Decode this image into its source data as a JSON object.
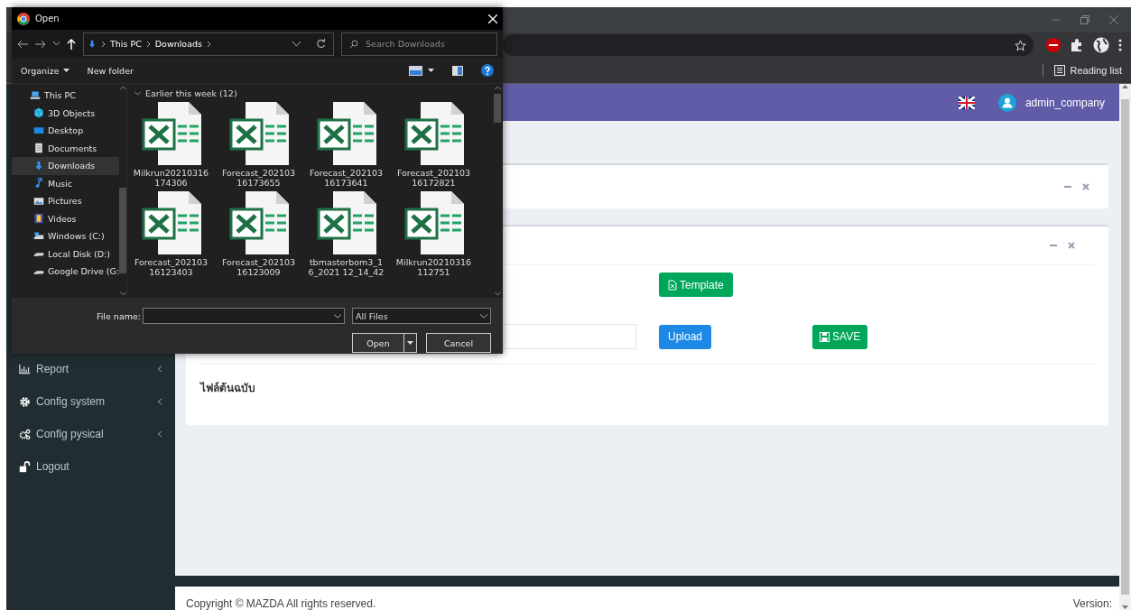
{
  "browser": {
    "reading_list": "Reading list"
  },
  "header": {
    "user": "admin_company"
  },
  "sidebar": {
    "items": [
      {
        "label": "Report",
        "kind": "chart"
      },
      {
        "label": "Config system",
        "kind": "gear"
      },
      {
        "label": "Config pysical",
        "kind": "gears"
      },
      {
        "label": "Logout",
        "kind": "lock"
      }
    ]
  },
  "upload_card": {
    "template_button": "Template",
    "upload_button": "Upload",
    "save_button": "SAVE",
    "section_title": "ไฟล์ต้นฉบับ"
  },
  "footer": {
    "copyright": "Copyright © MAZDA All rights reserved.",
    "version": "Version:"
  },
  "dialog": {
    "title": "Open",
    "breadcrumb": [
      "This PC",
      "Downloads"
    ],
    "search": {
      "placeholder": "Search Downloads"
    },
    "toolbar": [
      "Organize",
      "New folder"
    ],
    "nav_items": [
      {
        "label": "This PC",
        "kind": "pc",
        "selected": false
      },
      {
        "label": "3D Objects",
        "kind": "cube",
        "selected": false
      },
      {
        "label": "Desktop",
        "kind": "desktop",
        "selected": false
      },
      {
        "label": "Documents",
        "kind": "doc",
        "selected": false
      },
      {
        "label": "Downloads",
        "kind": "download",
        "selected": true
      },
      {
        "label": "Music",
        "kind": "music",
        "selected": false
      },
      {
        "label": "Pictures",
        "kind": "picture",
        "selected": false
      },
      {
        "label": "Videos",
        "kind": "video",
        "selected": false
      },
      {
        "label": "Windows (C:)",
        "kind": "drive",
        "selected": false
      },
      {
        "label": "Local Disk (D:)",
        "kind": "disk",
        "selected": false
      },
      {
        "label": "Google Drive (G:",
        "kind": "disk",
        "selected": false
      }
    ],
    "group": "Earlier this week (12)",
    "files": [
      {
        "name": [
          "Milkrun20210316",
          "174306"
        ]
      },
      {
        "name": [
          "Forecast_202103",
          "16173655"
        ]
      },
      {
        "name": [
          "Forecast_202103",
          "16173641"
        ]
      },
      {
        "name": [
          "Forecast_202103",
          "16172821"
        ]
      },
      {
        "name": [
          "Forecast_202103",
          "16123403"
        ]
      },
      {
        "name": [
          "Forecast_202103",
          "16123009"
        ]
      },
      {
        "name": [
          "tbmasterbom3_1",
          "6_2021 12_14_42"
        ]
      },
      {
        "name": [
          "Milkrun20210316",
          "112751"
        ]
      }
    ],
    "file_name_label": "File name:",
    "filter": "All Files",
    "open_button": "Open",
    "cancel_button": "Cancel"
  }
}
